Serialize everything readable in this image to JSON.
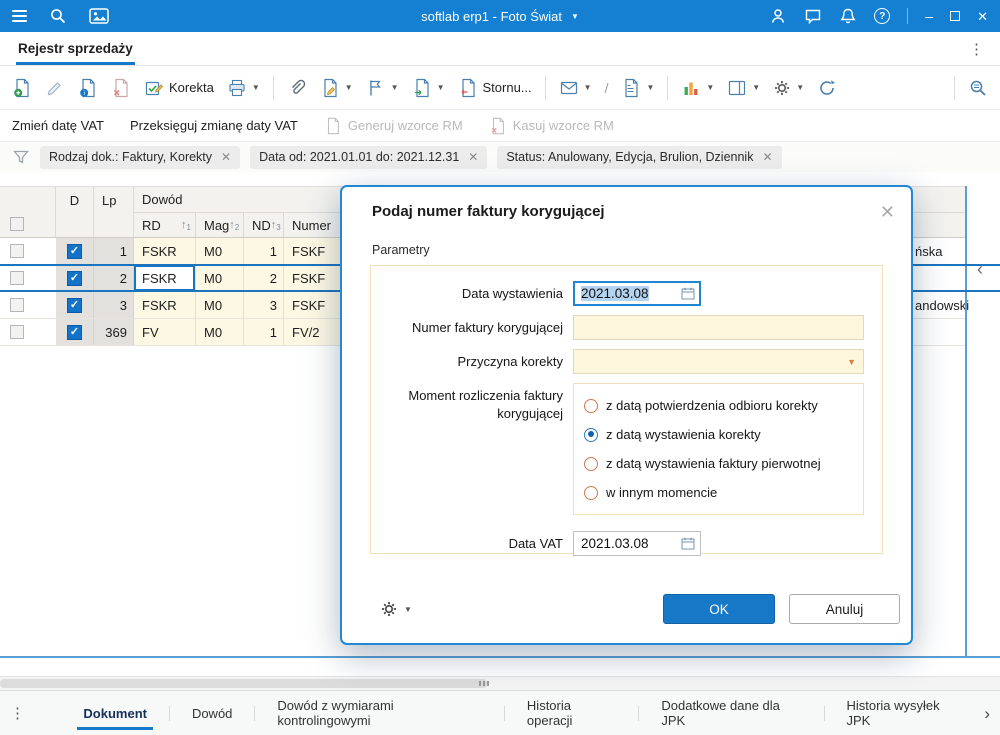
{
  "titlebar": {
    "title": "softlab erp1 - Foto Świat"
  },
  "page_tab": {
    "label": "Rejestr sprzedaży"
  },
  "toolbar": {
    "korekta_label": "Korekta",
    "storno_label": "Stornu...",
    "slash": "/"
  },
  "actions_row": {
    "items": [
      {
        "label": "Zmień datę VAT",
        "enabled": true
      },
      {
        "label": "Przeksięguj zmianę daty VAT",
        "enabled": true
      },
      {
        "label": "Generuj wzorce RM",
        "enabled": false
      },
      {
        "label": "Kasuj wzorce RM",
        "enabled": false
      }
    ]
  },
  "filters": {
    "chips": [
      {
        "label": "Rodzaj dok.: Faktury, Korekty"
      },
      {
        "label": "Data od: 2021.01.01 do: 2021.12.31"
      },
      {
        "label": "Status: Anulowany, Edycja, Brulion, Dziennik"
      }
    ]
  },
  "grid": {
    "group_header": "Dowód",
    "col_d": "D",
    "col_lp": "Lp",
    "subcols": [
      {
        "label": "RD",
        "sort": "1"
      },
      {
        "label": "Mag",
        "sort": "2"
      },
      {
        "label": "ND",
        "sort": "3"
      },
      {
        "label": "Numer",
        "sort": ""
      }
    ],
    "rows": [
      {
        "checked": true,
        "selected": false,
        "lp": "1",
        "rd": "FSKR",
        "mag": "M0",
        "nd": "1",
        "numer": "FSKF",
        "partial_right": "ńska"
      },
      {
        "checked": true,
        "selected": true,
        "lp": "2",
        "rd": "FSKR",
        "mag": "M0",
        "nd": "2",
        "numer": "FSKF",
        "partial_right": ""
      },
      {
        "checked": true,
        "selected": false,
        "lp": "3",
        "rd": "FSKR",
        "mag": "M0",
        "nd": "3",
        "numer": "FSKF",
        "partial_right": "andowski"
      },
      {
        "checked": true,
        "selected": false,
        "lp": "369",
        "rd": "FV",
        "mag": "M0",
        "nd": "1",
        "numer": "FV/2",
        "partial_right": ""
      }
    ]
  },
  "dialog": {
    "title": "Podaj numer faktury korygującej",
    "section": "Parametry",
    "fields": {
      "data_wystawienia": {
        "label": "Data wystawienia",
        "value": "2021.03.08"
      },
      "numer_faktury": {
        "label": "Numer faktury korygującej",
        "value": ""
      },
      "przyczyna": {
        "label": "Przyczyna korekty",
        "value": ""
      },
      "moment": {
        "label": "Moment rozliczenia faktury korygującej",
        "options": [
          {
            "label": "z datą potwierdzenia odbioru korekty",
            "selected": false
          },
          {
            "label": "z datą wystawienia korekty",
            "selected": true
          },
          {
            "label": "z datą wystawienia faktury pierwotnej",
            "selected": false
          },
          {
            "label": "w innym momencie",
            "selected": false
          }
        ]
      },
      "data_vat": {
        "label": "Data VAT",
        "value": "2021.03.08"
      }
    },
    "buttons": {
      "ok": "OK",
      "cancel": "Anuluj"
    }
  },
  "bottom_tabs": {
    "items": [
      {
        "label": "Dokument",
        "active": true
      },
      {
        "label": "Dowód",
        "active": false
      },
      {
        "label": "Dowód z wymiarami kontrolingowymi",
        "active": false
      },
      {
        "label": "Historia operacji",
        "active": false
      },
      {
        "label": "Dodatkowe dane dla JPK",
        "active": false
      },
      {
        "label": "Historia wysyłek JPK",
        "active": false
      }
    ]
  },
  "icons": {
    "menu": "hamburger-bars",
    "search": "magnifier",
    "gallery": "image-frame",
    "user": "person",
    "chat": "speech-bubble",
    "bell": "notifications",
    "help": "question-circle",
    "minimize": "dash",
    "maximize": "square",
    "close": "x",
    "filter": "funnel",
    "calendar": "calendar-grid",
    "settings": "gear",
    "refresh": "circular-arrow",
    "collapse": "chevron-left",
    "next": "chevron-right",
    "more": "vertical-dots"
  },
  "colors": {
    "titlebar": "#1580d2",
    "accent": "#1778c8",
    "selected_row": "#1b74c0",
    "cell_yellow": "#fcf8e3",
    "input_yellow": "#fdf6dc",
    "dialog_border": "#2188d8",
    "group_border": "#f3ddba",
    "radio_unselected": "#cf7a50",
    "ok_button": "#1878c8",
    "selection_highlight": "#b3d3f0",
    "disabled_text": "#b9b9b9"
  }
}
